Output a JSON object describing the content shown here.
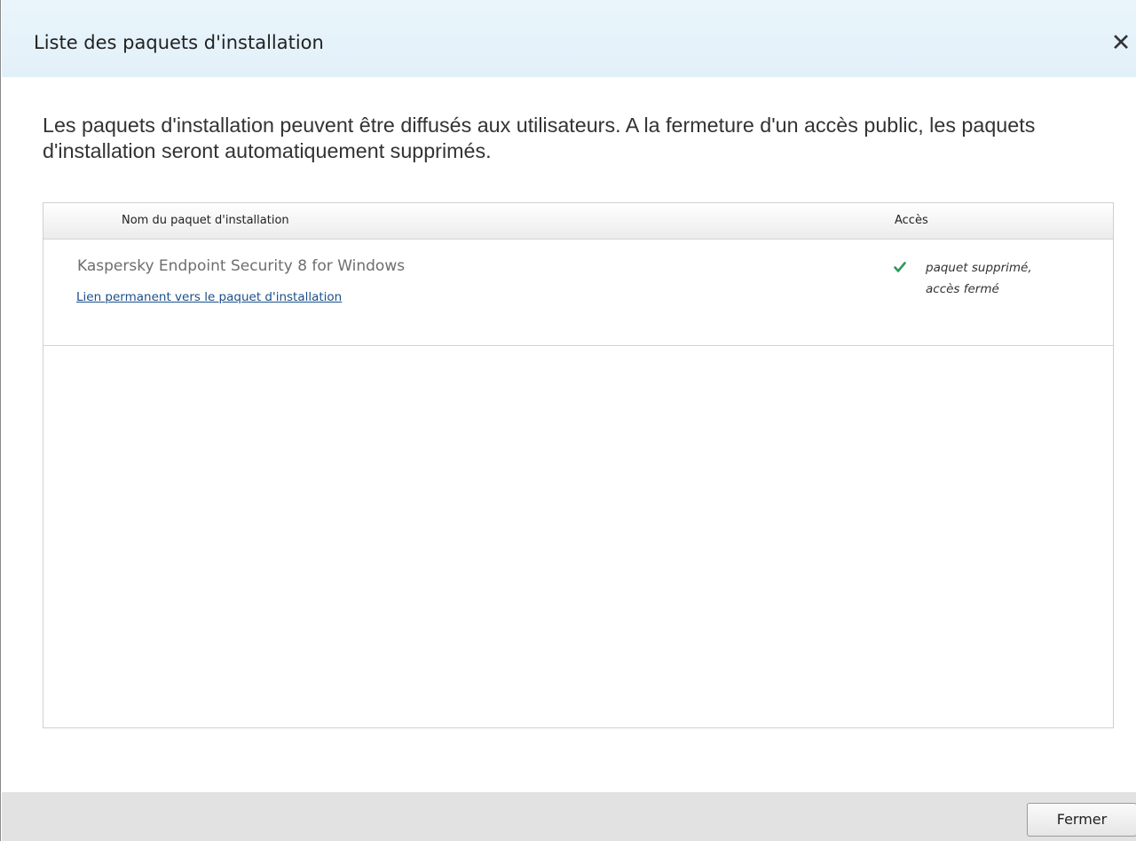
{
  "dialog": {
    "title": "Liste des paquets d'installation",
    "close_icon": "close-icon",
    "close_glyph": "✕"
  },
  "intro_text": "Les paquets d'installation peuvent être diffusés aux utilisateurs. A la fermeture d'un accès public, les paquets d'installation seront automatiquement supprimés.",
  "table": {
    "columns": [
      "Nom du paquet d'installation",
      "Accès"
    ],
    "rows": [
      {
        "name": "Kaspersky Endpoint Security 8 for Windows",
        "link": "Lien permanent vers le paquet d'installation",
        "status_icon": "check-icon",
        "status_line1": "paquet supprimé,",
        "status_line2": "accès fermé"
      }
    ]
  },
  "footer": {
    "close_label": "Fermer"
  },
  "colors": {
    "title_bar": "#e2f0f9",
    "link": "#1a4f8a",
    "check": "#2a9a5a",
    "footer": "#e2e2e2"
  }
}
